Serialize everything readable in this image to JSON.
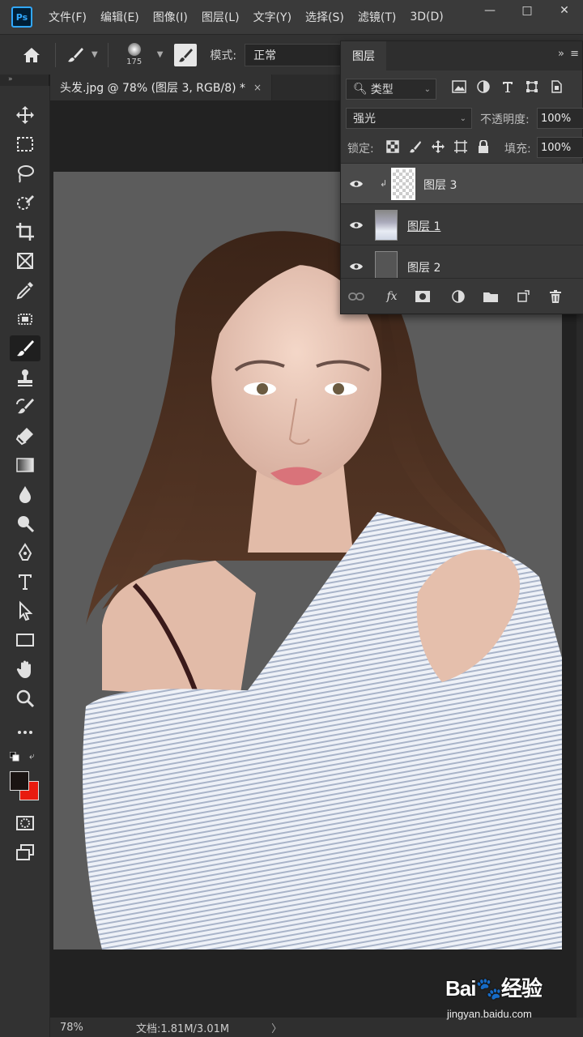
{
  "app": {
    "logo": "Ps"
  },
  "menu": [
    "文件(F)",
    "编辑(E)",
    "图像(I)",
    "图层(L)",
    "文字(Y)",
    "选择(S)",
    "滤镜(T)",
    "3D(D)"
  ],
  "window_controls": {
    "minimize": "—",
    "restore": "□",
    "close": "✕"
  },
  "options_bar": {
    "brush_size": "175",
    "mode_label": "模式:",
    "mode_value": "正常"
  },
  "panel_strip": {
    "collapse": "»"
  },
  "document_tab": {
    "title": "头发.jpg @ 78% (图层 3, RGB/8) *",
    "close": "×"
  },
  "status_bar": {
    "zoom": "78%",
    "doc_info": "文档:1.81M/3.01M",
    "arrow": "〉"
  },
  "layers_panel": {
    "tab_label": "图层",
    "collapse": "»",
    "menu": "≡",
    "filter_type": "类型",
    "blend_mode": "强光",
    "opacity_label": "不透明度:",
    "opacity_value": "100%",
    "lock_label": "锁定:",
    "fill_label": "填充:",
    "fill_value": "100%",
    "layers": [
      {
        "name": "图层 3",
        "selected": true,
        "visible": true,
        "thumb": "transparent",
        "clipped": true
      },
      {
        "name": "图层 1",
        "selected": false,
        "visible": true,
        "thumb": "photo",
        "clipped": false
      },
      {
        "name": "图层 2",
        "selected": false,
        "visible": true,
        "thumb": "gray",
        "clipped": false
      }
    ],
    "footer": {
      "fx": "fx"
    }
  },
  "watermark": {
    "logo": "Bai🐾经验",
    "url": "jingyan.baidu.com"
  },
  "colors": {
    "foreground": "#1a1412",
    "background": "#e81b0f",
    "accent": "#31a8ff"
  }
}
